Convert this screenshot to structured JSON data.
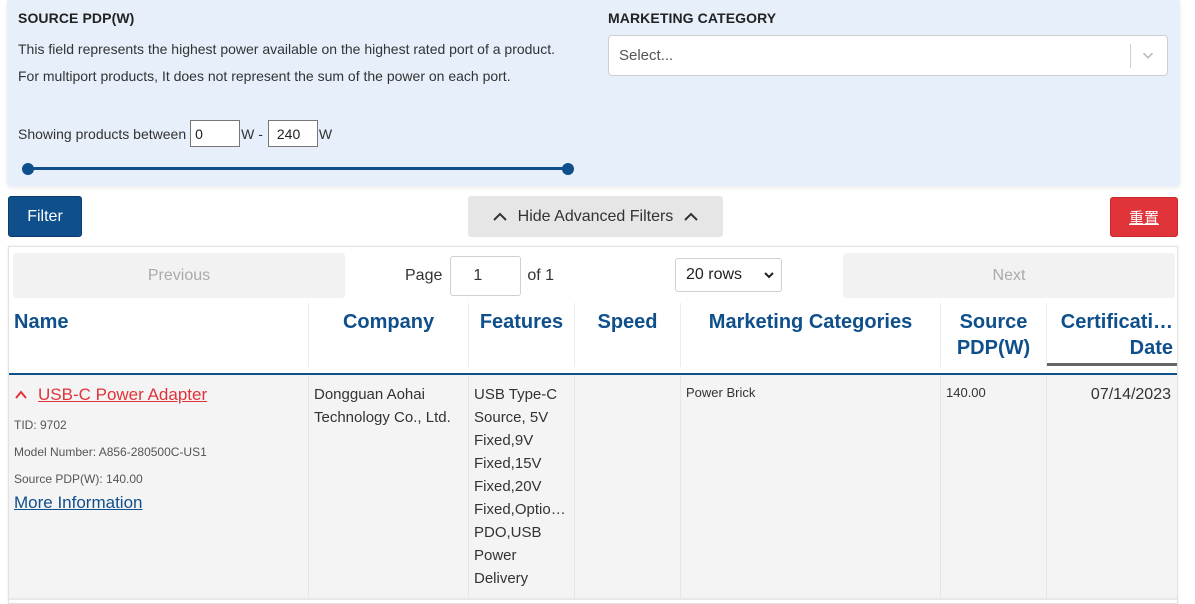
{
  "filters": {
    "pdp": {
      "title": "SOURCE PDP(W)",
      "description": "This field represents the highest power available on the highest rated port of a product. For multiport products, It does not represent the sum of the power on each port.",
      "showing_label": "Showing products between",
      "min_value": "0",
      "min_unit": "W -",
      "max_value": "240",
      "max_unit": "W",
      "range_min_fraction": 0,
      "range_max_fraction": 1
    },
    "marketing": {
      "title": "MARKETING CATEGORY",
      "placeholder": "Select..."
    }
  },
  "actions": {
    "filter_label": "Filter",
    "advanced_label": "Hide Advanced Filters",
    "reset_label": "重置"
  },
  "pager": {
    "previous_label": "Previous",
    "page_label": "Page",
    "page_value": "1",
    "of_label": "of 1",
    "rows_value": "20 rows",
    "next_label": "Next"
  },
  "table": {
    "headers": {
      "name": "Name",
      "company": "Company",
      "features": "Features",
      "speed": "Speed",
      "marketing": "Marketing Categories",
      "pdp_line1": "Source",
      "pdp_line2": "PDP(W)",
      "cert_line1": "Certificati…",
      "cert_line2": "Date"
    },
    "rows": [
      {
        "name": "USB-C Power Adapter",
        "tid": "TID: 9702",
        "model": "Model Number: A856-280500C-US1",
        "pdp_meta": "Source PDP(W): 140.00",
        "more_info": "More Information",
        "company": "Dongguan Aohai Technology Co., Ltd.",
        "features": "USB Type-C Source, 5V Fixed,9V Fixed,15V Fixed,20V Fixed,Optio… PDO,USB Power Delivery",
        "speed": "",
        "marketing": "Power Brick",
        "pdp": "140.00",
        "date": "07/14/2023"
      }
    ]
  },
  "colors": {
    "primary": "#0f4f8c",
    "danger": "#e0333a",
    "panel_bg": "#e6effa"
  }
}
